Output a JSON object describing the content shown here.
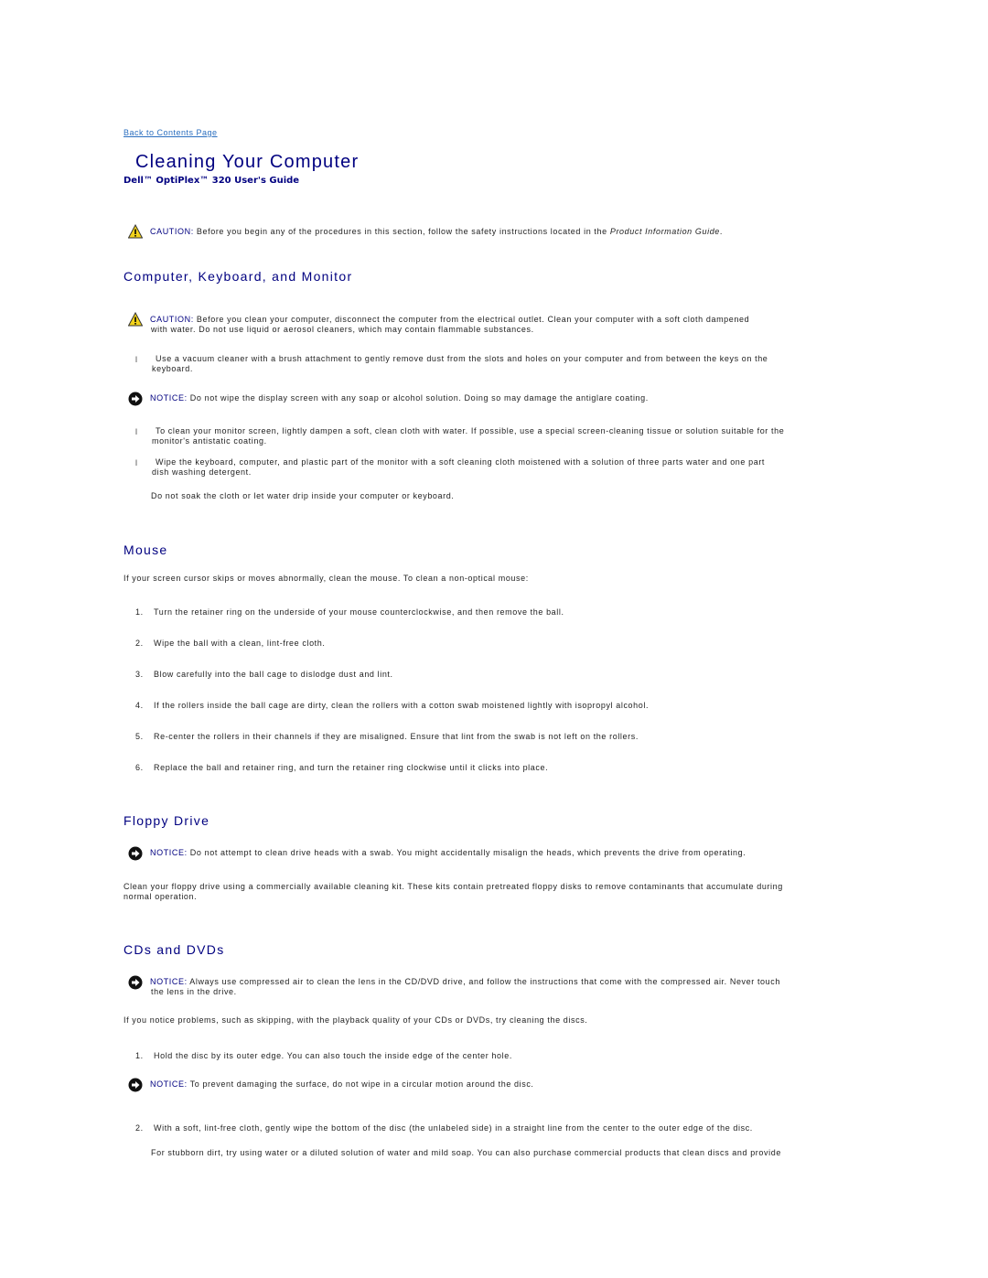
{
  "nav": {
    "back_link": "Back to Contents Page"
  },
  "header": {
    "title": "Cleaning Your Computer",
    "subtitle": "Dell™ OptiPlex™ 320 User's Guide"
  },
  "intro_caution": {
    "label": "CAUTION:",
    "text": " Before you begin any of the procedures in this section, follow the safety instructions located in the ",
    "emphasis": "Product Information Guide",
    "end": "."
  },
  "sections": {
    "computer": {
      "heading": "Computer, Keyboard, and Monitor",
      "caution_label": "CAUTION:",
      "caution_text_1": " Before you clean your computer, disconnect the computer from the electrical outlet. Clean your computer with a soft cloth dampened",
      "caution_text_2": "with water. Do not use liquid or aerosol cleaners, which may contain flammable substances.",
      "bullet1_line1": "Use a vacuum cleaner with a brush attachment to gently remove dust from the slots and holes on your computer and from between the keys on the",
      "bullet1_line2": "keyboard.",
      "notice_label": "NOTICE:",
      "notice_text": " Do not wipe the display screen with any soap or alcohol solution. Doing so may damage the antiglare coating.",
      "bullet2_line1": "To clean your monitor screen, lightly dampen a soft, clean cloth with water. If possible, use a special screen-cleaning tissue or solution suitable for the",
      "bullet2_line2": "monitor's antistatic coating.",
      "bullet3_line1": "Wipe the keyboard, computer, and plastic part of the monitor with a soft cleaning cloth moistened with a solution of three parts water and one part",
      "bullet3_line2": "dish washing detergent.",
      "note": "Do not soak the cloth or let water drip inside your computer or keyboard.",
      "bullet_glyph": "l"
    },
    "mouse": {
      "heading": "Mouse",
      "intro": "If your screen cursor skips or moves abnormally, clean the mouse. To clean a non-optical mouse:",
      "steps": [
        {
          "n": "1.",
          "text": "Turn the retainer ring on the underside of your mouse counterclockwise, and then remove the ball."
        },
        {
          "n": "2.",
          "text": "Wipe the ball with a clean, lint-free cloth."
        },
        {
          "n": "3.",
          "text": "Blow carefully into the ball cage to dislodge dust and lint."
        },
        {
          "n": "4.",
          "text": "If the rollers inside the ball cage are dirty, clean the rollers with a cotton swab moistened lightly with isopropyl alcohol."
        },
        {
          "n": "5.",
          "text": "Re-center the rollers in their channels if they are misaligned. Ensure that lint from the swab is not left on the rollers."
        },
        {
          "n": "6.",
          "text": "Replace the ball and retainer ring, and turn the retainer ring clockwise until it clicks into place."
        }
      ]
    },
    "floppy": {
      "heading": "Floppy Drive",
      "notice_label": "NOTICE:",
      "notice_text": " Do not attempt to clean drive heads with a swab. You might accidentally misalign the heads, which prevents the drive from operating.",
      "body_line1": "Clean your floppy drive using a commercially available cleaning kit. These kits contain pretreated floppy disks to remove contaminants that accumulate during",
      "body_line2": "normal operation."
    },
    "cds": {
      "heading": "CDs and DVDs",
      "notice_label": "NOTICE:",
      "notice_text_1": " Always use compressed air to clean the lens in the CD/DVD drive, and follow the instructions that come with the compressed air. Never touch",
      "notice_text_2": "the lens in the drive.",
      "intro": "If you notice problems, such as skipping, with the playback quality of your CDs or DVDs, try cleaning the discs.",
      "step1_n": "1.",
      "step1": "Hold the disc by its outer edge. You can also touch the inside edge of the center hole.",
      "notice2_label": "NOTICE:",
      "notice2_text": " To prevent damaging the surface, do not wipe in a circular motion around the disc.",
      "step2_n": "2.",
      "step2": "With a soft, lint-free cloth, gently wipe the bottom of the disc (the unlabeled side) in a straight line from the center to the outer edge of the disc.",
      "step2_note": "For stubborn dirt, try using water or a diluted solution of water and mild soap. You can also purchase commercial products that clean discs and provide"
    }
  },
  "colors": {
    "heading": "#000080",
    "link": "#2a6ebf",
    "caution_yellow": "#f2d21b"
  }
}
